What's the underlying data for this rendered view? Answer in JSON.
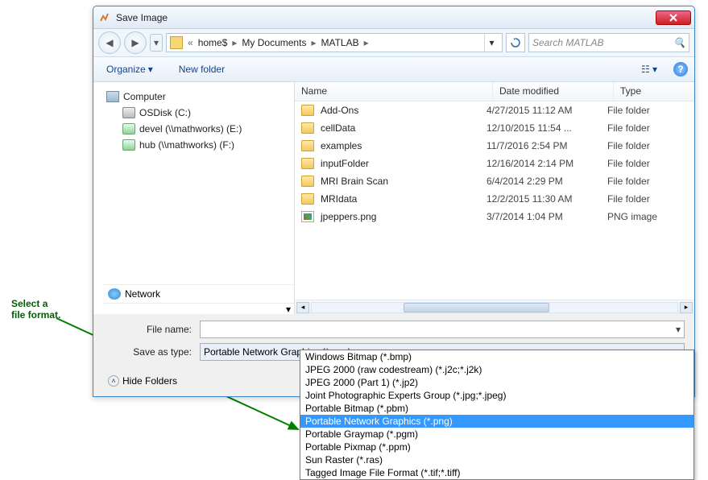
{
  "annotation": {
    "line1": "Select a",
    "line2": "file format."
  },
  "window": {
    "title": "Save Image"
  },
  "breadcrumb": {
    "segs": [
      "home$",
      "My Documents",
      "MATLAB"
    ]
  },
  "search": {
    "placeholder": "Search MATLAB"
  },
  "toolbar": {
    "organize": "Organize",
    "newfolder": "New folder"
  },
  "tree": {
    "computer": "Computer",
    "items": [
      {
        "label": "OSDisk (C:)"
      },
      {
        "label": "devel (\\\\mathworks) (E:)"
      },
      {
        "label": "hub (\\\\mathworks) (F:)"
      }
    ],
    "network": "Network"
  },
  "columns": {
    "name": "Name",
    "date": "Date modified",
    "type": "Type"
  },
  "files": [
    {
      "name": "Add-Ons",
      "date": "4/27/2015 11:12 AM",
      "type": "File folder",
      "icon": "folder"
    },
    {
      "name": "cellData",
      "date": "12/10/2015 11:54 ...",
      "type": "File folder",
      "icon": "folder"
    },
    {
      "name": "examples",
      "date": "11/7/2016 2:54 PM",
      "type": "File folder",
      "icon": "folder"
    },
    {
      "name": "inputFolder",
      "date": "12/16/2014 2:14 PM",
      "type": "File folder",
      "icon": "folder"
    },
    {
      "name": "MRI Brain Scan",
      "date": "6/4/2014 2:29 PM",
      "type": "File folder",
      "icon": "folder"
    },
    {
      "name": "MRIdata",
      "date": "12/2/2015 11:30 AM",
      "type": "File folder",
      "icon": "folder"
    },
    {
      "name": "jpeppers.png",
      "date": "3/7/2014 1:04 PM",
      "type": "PNG image",
      "icon": "png"
    }
  ],
  "form": {
    "filename_label": "File name:",
    "filename_value": "",
    "saveas_label": "Save as type:",
    "saveas_value": "Portable Network Graphics (*.png)",
    "hide": "Hide Folders"
  },
  "dropdown": {
    "selected_index": 5,
    "items": [
      "Windows Bitmap (*.bmp)",
      "JPEG 2000 (raw codestream) (*.j2c;*.j2k)",
      "JPEG 2000 (Part 1) (*.jp2)",
      "Joint Photographic Experts Group (*.jpg;*.jpeg)",
      "Portable Bitmap (*.pbm)",
      "Portable Network Graphics (*.png)",
      "Portable Graymap (*.pgm)",
      "Portable Pixmap (*.ppm)",
      "Sun Raster (*.ras)",
      "Tagged Image File Format (*.tif;*.tiff)"
    ]
  }
}
